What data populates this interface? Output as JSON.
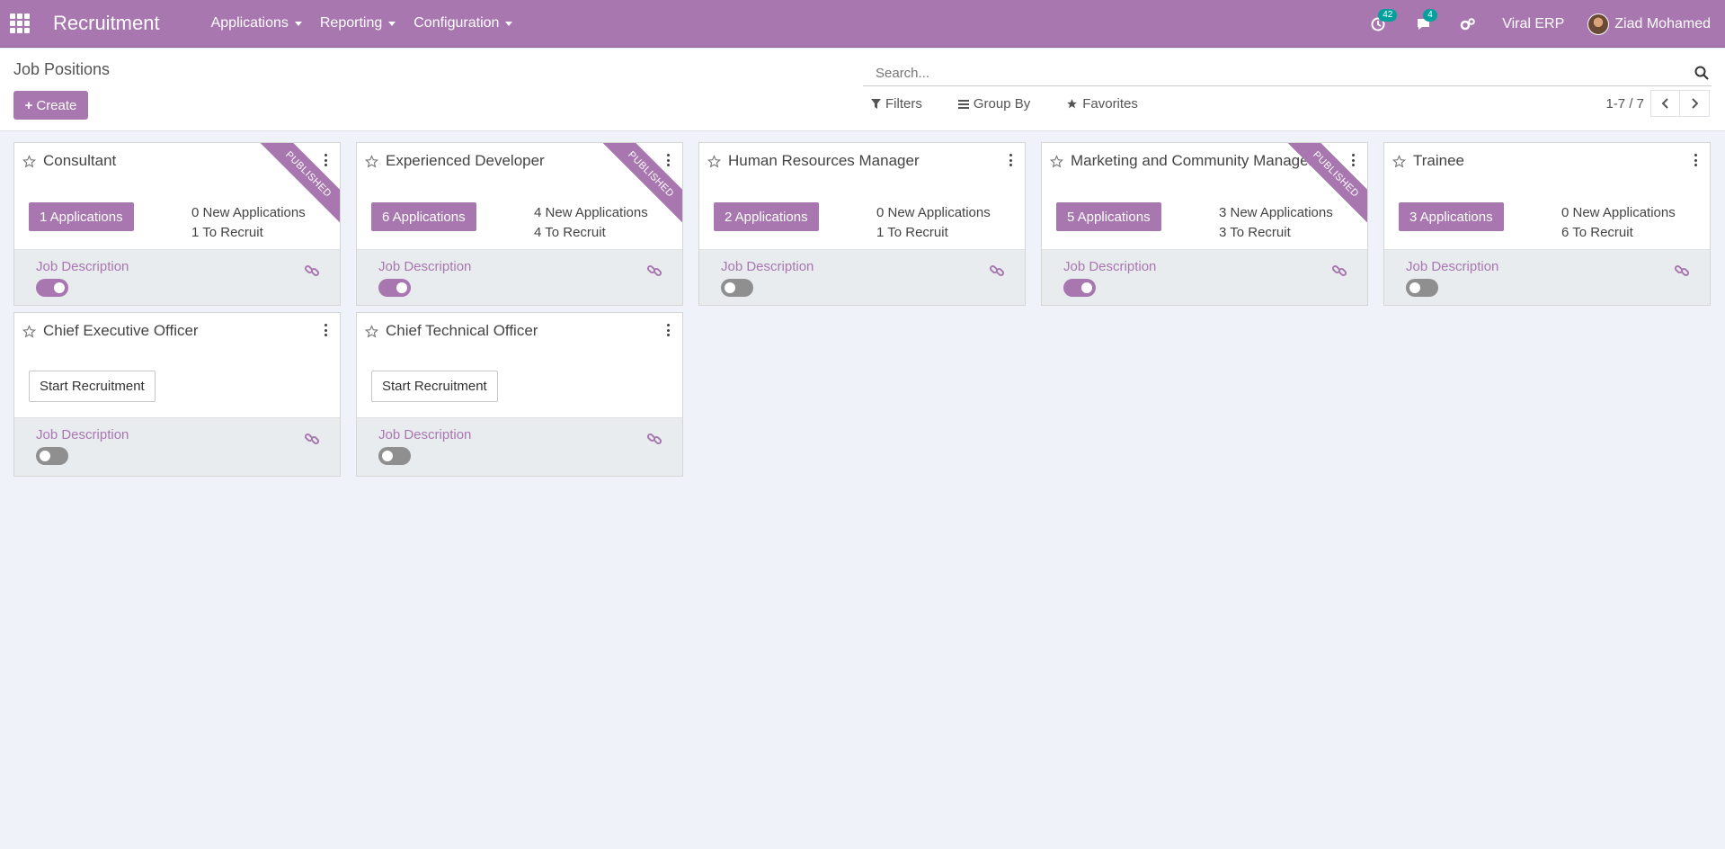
{
  "navbar": {
    "app_name": "Recruitment",
    "menus": [
      "Applications",
      "Reporting",
      "Configuration"
    ],
    "activity_count": "42",
    "message_count": "4",
    "company": "Viral ERP",
    "user": "Ziad Mohamed",
    "accent_color": "#a877b0"
  },
  "control": {
    "page_title": "Job Positions",
    "create_label": "Create",
    "search_placeholder": "Search...",
    "filters_label": "Filters",
    "group_by_label": "Group By",
    "favorites_label": "Favorites",
    "pager": "1-7 / 7"
  },
  "jobs": [
    {
      "title": "Consultant",
      "published": true,
      "ribbon": "PUBLISHED",
      "applications": "1 Applications",
      "new_apps": "0 New Applications",
      "to_recruit": "1 To Recruit",
      "jd": "Job Description",
      "website_published": true
    },
    {
      "title": "Experienced Developer",
      "published": true,
      "ribbon": "PUBLISHED",
      "applications": "6 Applications",
      "new_apps": "4 New Applications",
      "to_recruit": "4 To Recruit",
      "jd": "Job Description",
      "website_published": true
    },
    {
      "title": "Human Resources Manager",
      "published": false,
      "applications": "2 Applications",
      "new_apps": "0 New Applications",
      "to_recruit": "1 To Recruit",
      "jd": "Job Description",
      "website_published": false
    },
    {
      "title": "Marketing and Community Manager",
      "published": true,
      "ribbon": "PUBLISHED",
      "applications": "5 Applications",
      "new_apps": "3 New Applications",
      "to_recruit": "3 To Recruit",
      "jd": "Job Description",
      "website_published": true
    },
    {
      "title": "Trainee",
      "published": false,
      "applications": "3 Applications",
      "new_apps": "0 New Applications",
      "to_recruit": "6 To Recruit",
      "jd": "Job Description",
      "website_published": false
    },
    {
      "title": "Chief Executive Officer",
      "published": false,
      "start_label": "Start Recruitment",
      "jd": "Job Description",
      "website_published": false
    },
    {
      "title": "Chief Technical Officer",
      "published": false,
      "start_label": "Start Recruitment",
      "jd": "Job Description",
      "website_published": false
    }
  ]
}
